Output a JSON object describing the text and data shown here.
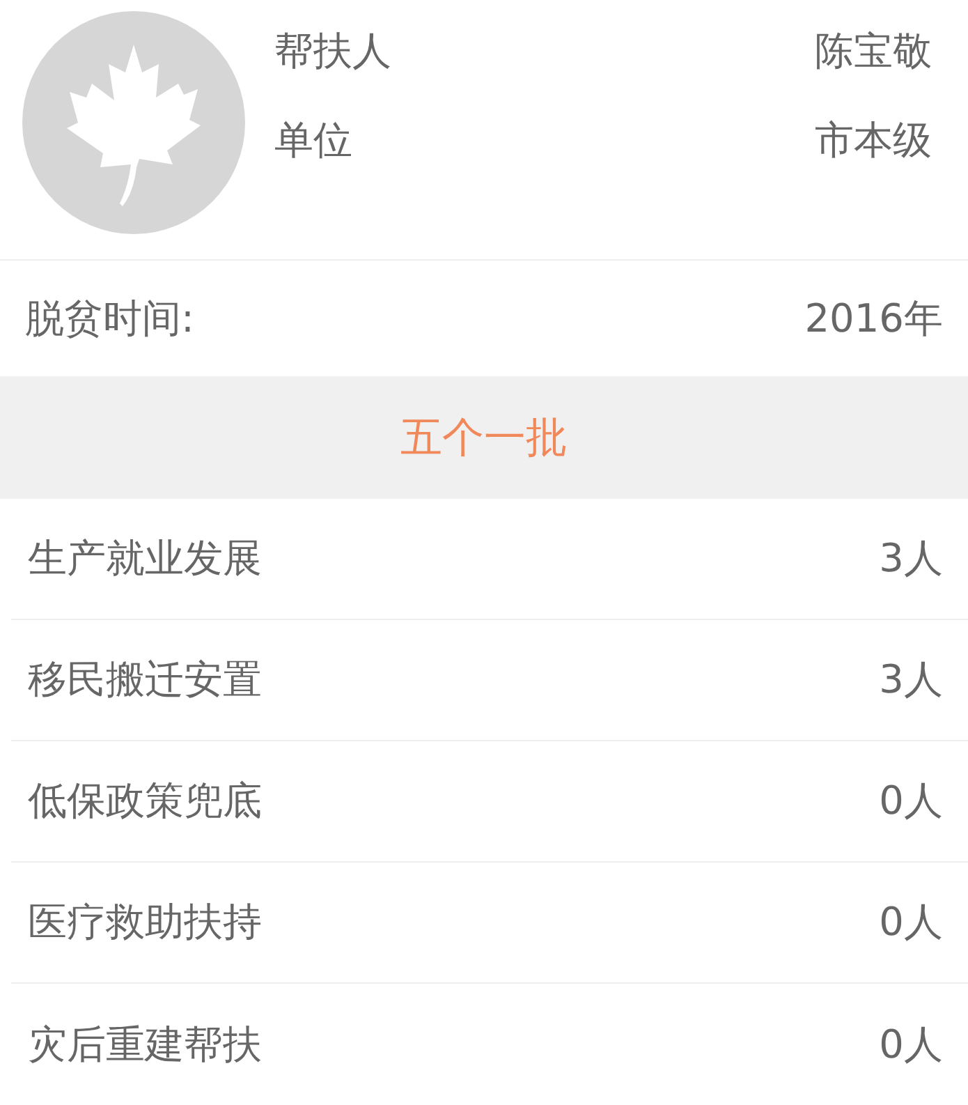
{
  "profile": {
    "fields": [
      {
        "label": "帮扶人",
        "value": "陈宝敬"
      },
      {
        "label": "单位",
        "value": "市本级"
      }
    ]
  },
  "exit_time": {
    "label": "脱贫时间:",
    "value": "2016年"
  },
  "section": {
    "title": "五个一批"
  },
  "rows": [
    {
      "label": "生产就业发展",
      "value": "3人"
    },
    {
      "label": "移民搬迁安置",
      "value": "3人"
    },
    {
      "label": "低保政策兜底",
      "value": "0人"
    },
    {
      "label": "医疗救助扶持",
      "value": "0人"
    },
    {
      "label": "灾后重建帮扶",
      "value": "0人"
    }
  ]
}
